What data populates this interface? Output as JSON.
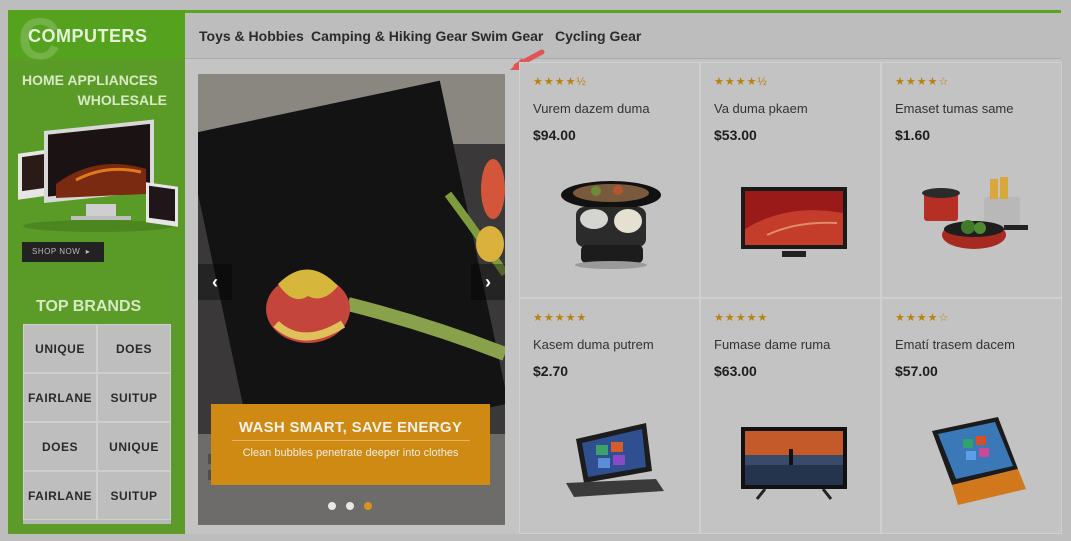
{
  "category": {
    "title": "COMPUTERS",
    "big_letter": "C"
  },
  "nav": {
    "items": [
      "Toys & Hobbies",
      "Camping & Hiking Gear",
      "Swim Gear",
      "Cycling Gear"
    ]
  },
  "promo": {
    "line1": "HOME APPLIANCES",
    "line2": "WHOLESALE",
    "button": "SHOP NOW"
  },
  "brands": {
    "title": "TOP BRANDS",
    "items": [
      "UNIQUE",
      "DOES",
      "FAIRLANE",
      "SUITUP",
      "DOES",
      "UNIQUE",
      "FAIRLANE",
      "SUITUP"
    ]
  },
  "slider": {
    "caption_title": "WASH SMART, SAVE ENERGY",
    "caption_text": "Clean bubbles penetrate deeper into clothes",
    "prev": "‹",
    "next": "›",
    "active_dot": 3,
    "dot_count": 3
  },
  "products": [
    {
      "name": "Vurem dazem duma",
      "price": "$94.00",
      "stars": "★★★★½",
      "icon": "slow-cooker-icon"
    },
    {
      "name": "Va duma pkaem",
      "price": "$53.00",
      "stars": "★★★★½",
      "icon": "tv-icon"
    },
    {
      "name": "Emaset tumas same",
      "price": "$1.60",
      "stars": "★★★★☆",
      "icon": "cookware-icon"
    },
    {
      "name": "Kasem duma putrem",
      "price": "$2.70",
      "stars": "★★★★★",
      "icon": "laptop-icon"
    },
    {
      "name": "Fumase dame ruma",
      "price": "$63.00",
      "stars": "★★★★★",
      "icon": "tv-icon"
    },
    {
      "name": "Ematí trasem dacem",
      "price": "$57.00",
      "stars": "★★★★☆",
      "icon": "tablet-laptop-icon"
    }
  ],
  "colors": {
    "accent_green": "#5aa51e",
    "caption_orange": "#cf8a13",
    "star": "#b9810f",
    "pointer": "#e05555"
  }
}
